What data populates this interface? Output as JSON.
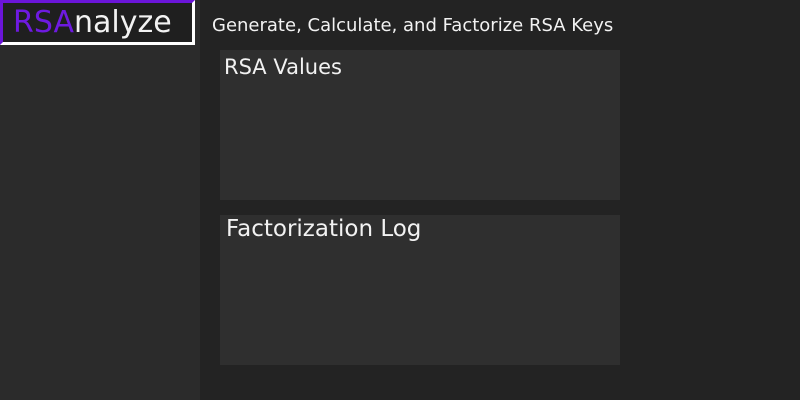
{
  "logo": {
    "accent_text": "RSA",
    "rest_text": "nalyze"
  },
  "header": {
    "subtitle": "Generate, Calculate, and Factorize RSA Keys"
  },
  "panels": {
    "values": {
      "title": "RSA Values"
    },
    "log": {
      "title": "Factorization Log"
    }
  },
  "colors": {
    "accent": "#6e1ae0",
    "background": "#232323",
    "sidebar": "#2b2b2b",
    "panel": "#2f2f2f",
    "text": "#f2f2f2"
  }
}
